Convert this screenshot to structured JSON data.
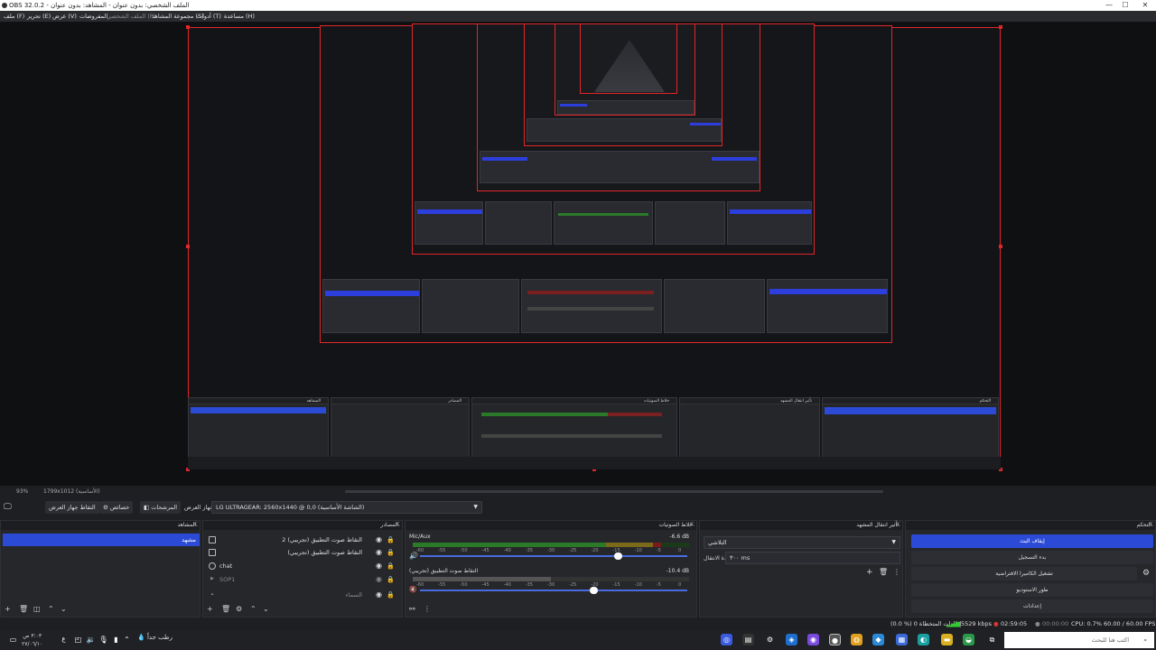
{
  "window": {
    "title": "OBS 32.0.2 - الملف الشخصي: بدون عنوان - المشاهد: بدون عنوان",
    "minimize": "—",
    "maximize": "☐",
    "close": "✕"
  },
  "menu": [
    {
      "label": "ملف (F)"
    },
    {
      "label": "تحرير (E)"
    },
    {
      "label": "عرض (V)"
    },
    {
      "label": "المفروضات"
    },
    {
      "label": "الملف الشخصي (P)",
      "dim": true
    },
    {
      "label": "مجموعة المشاهد (S)"
    },
    {
      "label": "أدوات (T)"
    },
    {
      "label": "مساعدة (H)"
    }
  ],
  "zoom": {
    "percent": "93%",
    "resolution": "1799x1012 (الأساسية)"
  },
  "toolbar": {
    "monitor_label": "جهاز العرض",
    "filters_label": "المرشحات",
    "properties_label": "خصائص",
    "capture_label": "التقاط جهاز العرض",
    "display_source": "LG ULTRAGEAR: 2560x1440 @ 0,0 (الشاشة الأساسية)"
  },
  "scenes": {
    "title": "المشاهد",
    "items": [
      "مشهد"
    ]
  },
  "sources": {
    "title": "المصادر",
    "items": [
      {
        "label": "التقاط صوت التطبيق (تجريبي) 2",
        "icon": "app-audio"
      },
      {
        "label": "التقاط صوت التطبيق (تجريبي)",
        "icon": "app-audio"
      },
      {
        "label": "chat",
        "icon": "browser"
      },
      {
        "label": "SOP1",
        "icon": "media"
      },
      {
        "label": "السماء",
        "icon": "folder"
      }
    ]
  },
  "mixer": {
    "title": "خلاط الصوتيات",
    "channels": [
      {
        "name": "Mic/Aux",
        "db": "-6.6 dB",
        "level": 0.9,
        "volume": 0.74
      },
      {
        "name": "التقاط صوت التطبيق (تجريبي)",
        "db": "-10.4 dB",
        "level": 0.5,
        "volume": 0.65
      }
    ],
    "ticks": [
      "-60",
      "-55",
      "-50",
      "-45",
      "-40",
      "-35",
      "-30",
      "-25",
      "-20",
      "-15",
      "-10",
      "-5",
      "0"
    ]
  },
  "transitions": {
    "title": "تأثير انتقال المشهد",
    "selected": "التلاشي",
    "duration_label": "مدة الانتقال",
    "duration_value": "٣٠٠ ms"
  },
  "controls": {
    "title": "التحكم",
    "buttons": [
      {
        "label": "إيقاف البث",
        "active": true
      },
      {
        "label": "بدء التسجيل",
        "active": false
      },
      {
        "label": "تشغيل الكاميرا الافتراضية",
        "active": false
      },
      {
        "label": "طور الاستوديو",
        "active": false
      },
      {
        "label": "إعدادات",
        "active": false
      }
    ]
  },
  "status": {
    "dropped": "(0.0 %) إطارات المتخطاة 0",
    "bitrate": "5529 kbps",
    "stream_time": "02:59:05",
    "rec_time": "00:00:00",
    "cpu": "CPU: 0.7%",
    "fps": "60.00 / 60.00 FPS"
  },
  "taskbar": {
    "search_placeholder": "اكتب هنا للبحث",
    "time": "٣:٠٣ ص",
    "date": "٢٧/٠٦/١٠",
    "weather": "رطب جداً"
  },
  "colors": {
    "accent": "#2b4bd6",
    "frame": "#e0262a",
    "panel": "#26272b"
  }
}
